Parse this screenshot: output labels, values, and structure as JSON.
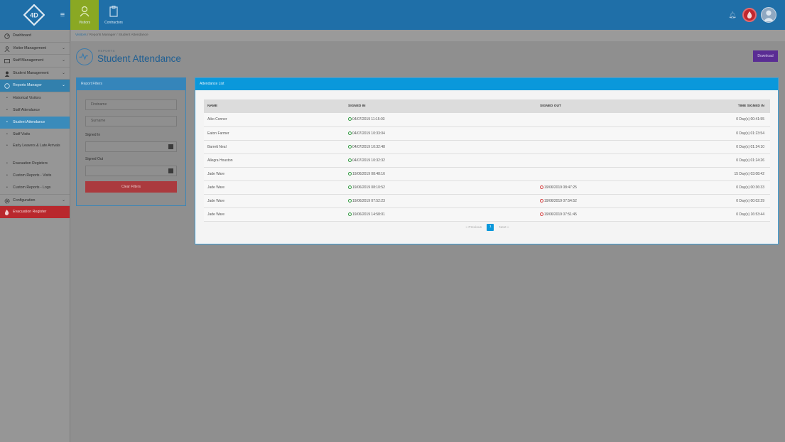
{
  "topbar": {
    "modules": [
      {
        "label": "Visitors",
        "active": true
      },
      {
        "label": "Contractors",
        "active": false
      }
    ],
    "logo_text": "4D"
  },
  "sidebar": {
    "items": [
      {
        "label": "Dashboard",
        "icon": "speedometer-icon"
      },
      {
        "label": "Visitor Management",
        "icon": "user-icon"
      },
      {
        "label": "Staff Management",
        "icon": "id-card-icon"
      },
      {
        "label": "Student Management",
        "icon": "student-icon"
      },
      {
        "label": "Reports Manager",
        "icon": "report-icon"
      }
    ],
    "submenu": [
      {
        "label": "Historical Visitors"
      },
      {
        "label": "Staff Attendance"
      },
      {
        "label": "Student Attendance",
        "active": true
      },
      {
        "label": "Staff Visits"
      },
      {
        "label": "Early Leavers & Late Arrivals"
      },
      {
        "label": "Evacuation Registers"
      },
      {
        "label": "Custom Reports - Visits"
      },
      {
        "label": "Custom Reports - Logs"
      }
    ],
    "configuration": "Configuration",
    "evacuation": "Evacuation Register"
  },
  "breadcrumb": [
    "Visitors",
    "Reports Manager",
    "Student Attendance"
  ],
  "page": {
    "subtitle": "REPORTS",
    "title": "Student Attendance",
    "download_label": "Download"
  },
  "filters": {
    "title": "Report Filters",
    "firstname_placeholder": "Firstname",
    "surname_placeholder": "Surname",
    "signed_in_label": "Signed In",
    "signed_out_label": "Signed Out",
    "clear_label": "Clear Filters"
  },
  "attendance": {
    "title": "Attendance List",
    "columns": [
      "NAME",
      "SIGNED IN",
      "SIGNED OUT",
      "TIME SIGNED IN"
    ],
    "rows": [
      {
        "name": "Aiko Conner",
        "signed_in": "04/07/2019 11:15:03",
        "signed_out": "",
        "time": "0 Day(s) 00:41:55"
      },
      {
        "name": "Eaton Farmer",
        "signed_in": "04/07/2019 10:33:04",
        "signed_out": "",
        "time": "0 Day(s) 01:23:54"
      },
      {
        "name": "Barrett Neal",
        "signed_in": "04/07/2019 10:32:48",
        "signed_out": "",
        "time": "0 Day(s) 01:24:10"
      },
      {
        "name": "Allegra Houston",
        "signed_in": "04/07/2019 10:32:32",
        "signed_out": "",
        "time": "0 Day(s) 01:24:26"
      },
      {
        "name": "Jade Ware",
        "signed_in": "19/06/2019 08:48:16",
        "signed_out": "",
        "time": "15 Day(s) 03:08:42"
      },
      {
        "name": "Jade Ware",
        "signed_in": "19/06/2019 08:10:52",
        "signed_out": "19/06/2019 08:47:25",
        "time": "0 Day(s) 00:36:33"
      },
      {
        "name": "Jade Ware",
        "signed_in": "19/06/2019 07:52:23",
        "signed_out": "19/06/2019 07:54:52",
        "time": "0 Day(s) 00:02:29"
      },
      {
        "name": "Jade Ware",
        "signed_in": "19/06/2019 14:58:01",
        "signed_out": "19/06/2019 07:51:45",
        "time": "0 Day(s) 16:53:44"
      }
    ],
    "pager": {
      "previous": "« Previous",
      "page": "1",
      "next": "Next »"
    }
  }
}
